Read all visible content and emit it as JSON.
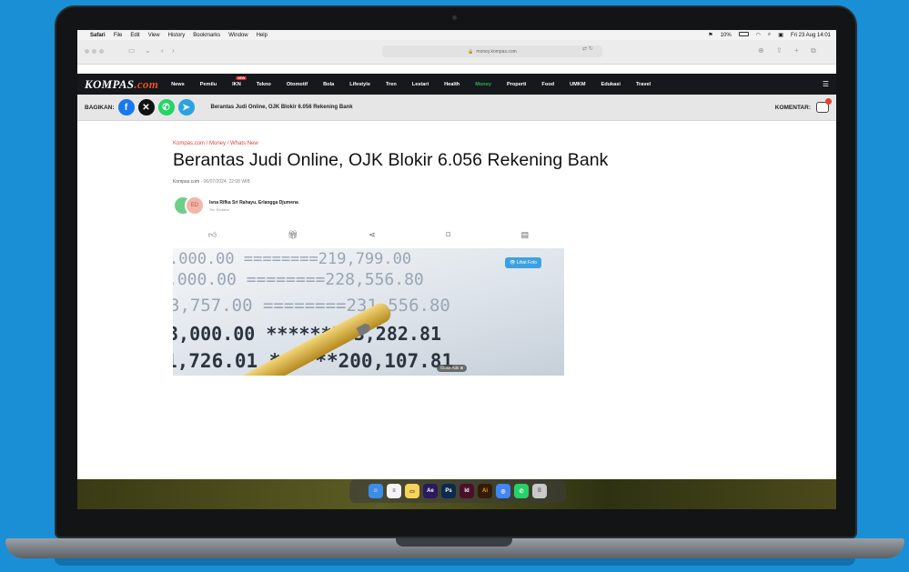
{
  "menubar": {
    "app": "Safari",
    "items": [
      "File",
      "Edit",
      "View",
      "History",
      "Bookmarks",
      "Window",
      "Help"
    ],
    "battery": "10%",
    "datetime": "Fri 23 Aug 14:01"
  },
  "browser": {
    "url": "money.kompas.com"
  },
  "site": {
    "logo_main": "KOMPAS",
    "logo_suffix": ".com",
    "nav": [
      "News",
      "Pemilu",
      "IKN",
      "Tekno",
      "Otomotif",
      "Bola",
      "Lifestyle",
      "Tren",
      "Lestari",
      "Health",
      "Money",
      "Properti",
      "Food",
      "UMKM",
      "Edukasi",
      "Travel"
    ],
    "active_nav": "Money",
    "ikn_badge": "NEW"
  },
  "sharebar": {
    "label": "BAGIKAN:",
    "title": "Berantas Judi Online, OJK Blokir 6.056 Rekening Bank",
    "komentar": "KOMENTAR:"
  },
  "article": {
    "breadcrumb": "Kompas.com / Money / Whats New",
    "title": "Berantas Judi Online, OJK Blokir 6.056 Rekening Bank",
    "source": "Kompas.com",
    "date": " - 06/07/2024, 22:08 WIB",
    "authors": "Isna Rifka Sri Rahayu, Erlangga Djumena",
    "author_role": "Tim Redaksi",
    "avatar_initials": "ED",
    "see_photo": "Lihat Foto",
    "close_ad": "Close Ads",
    "ledger_lines": [
      ".000.00    ========219,799.00",
      ".000.00    ========228,556.80",
      "3,757.00   ========231,556.80",
      "3,000.00  ******303,282.81",
      "1,726.01  ******200,107.81"
    ]
  },
  "dock_apps": [
    "Finder",
    "Notes",
    "Notes2",
    "Ae",
    "Ps",
    "Id",
    "Ai",
    "Chrome",
    "WhatsApp",
    "Trash"
  ]
}
